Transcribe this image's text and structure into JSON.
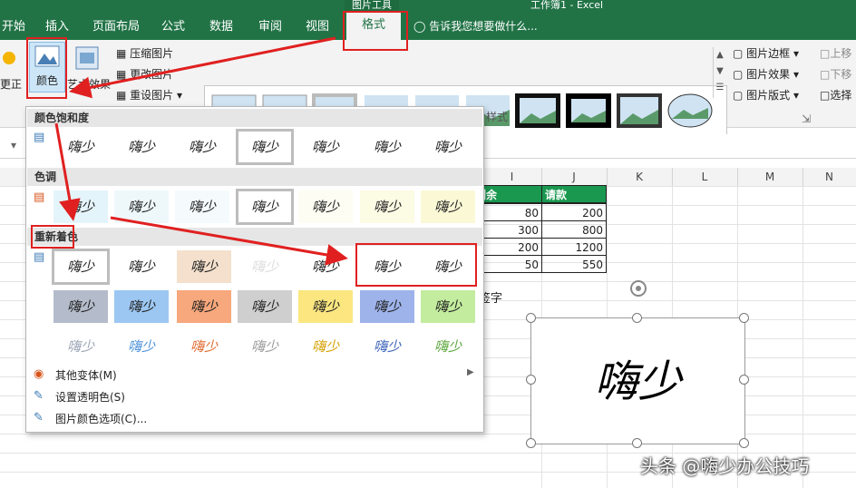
{
  "window": {
    "title_tool": "图片工具",
    "title_app": "工作簿1 - Excel"
  },
  "tabs": [
    {
      "label": "开始"
    },
    {
      "label": "插入"
    },
    {
      "label": "页面布局"
    },
    {
      "label": "公式"
    },
    {
      "label": "数据"
    },
    {
      "label": "审阅"
    },
    {
      "label": "视图"
    },
    {
      "label": "格式"
    }
  ],
  "tell_me": "告诉我您想要做什么...",
  "ribbon": {
    "correct": "更正",
    "color": "颜色",
    "artistic": "艺术效果",
    "compress": "压缩图片",
    "change": "更改图片",
    "reset": "重设图片",
    "border": "图片边框",
    "effects": "图片效果",
    "layout": "图片版式",
    "styles_group": "图片样式",
    "bring_forward": "上移",
    "send_backward": "下移",
    "selection": "选择"
  },
  "menu": {
    "saturation_title": "颜色饱和度",
    "tone_title": "色调",
    "recolor_title": "重新着色",
    "swatch_text": "嗨少",
    "more_variations": "其他变体(M)",
    "set_transparent": "设置透明色(S)",
    "color_options": "图片颜色选项(C)..."
  },
  "sheet": {
    "columns": [
      "I",
      "J",
      "K",
      "L",
      "M",
      "N"
    ],
    "headers": [
      "剩余",
      "请款"
    ],
    "rows": [
      [
        "80",
        "200"
      ],
      [
        "300",
        "800"
      ],
      [
        "200",
        "1200"
      ],
      [
        "50",
        "550"
      ]
    ],
    "sign_label": "签字",
    "signature_text": "嗨少"
  },
  "watermark": "头条 @嗨少办公技巧",
  "colors": {
    "excel_green": "#217346",
    "header_green": "#1a9850",
    "highlight_red": "#e02020"
  }
}
